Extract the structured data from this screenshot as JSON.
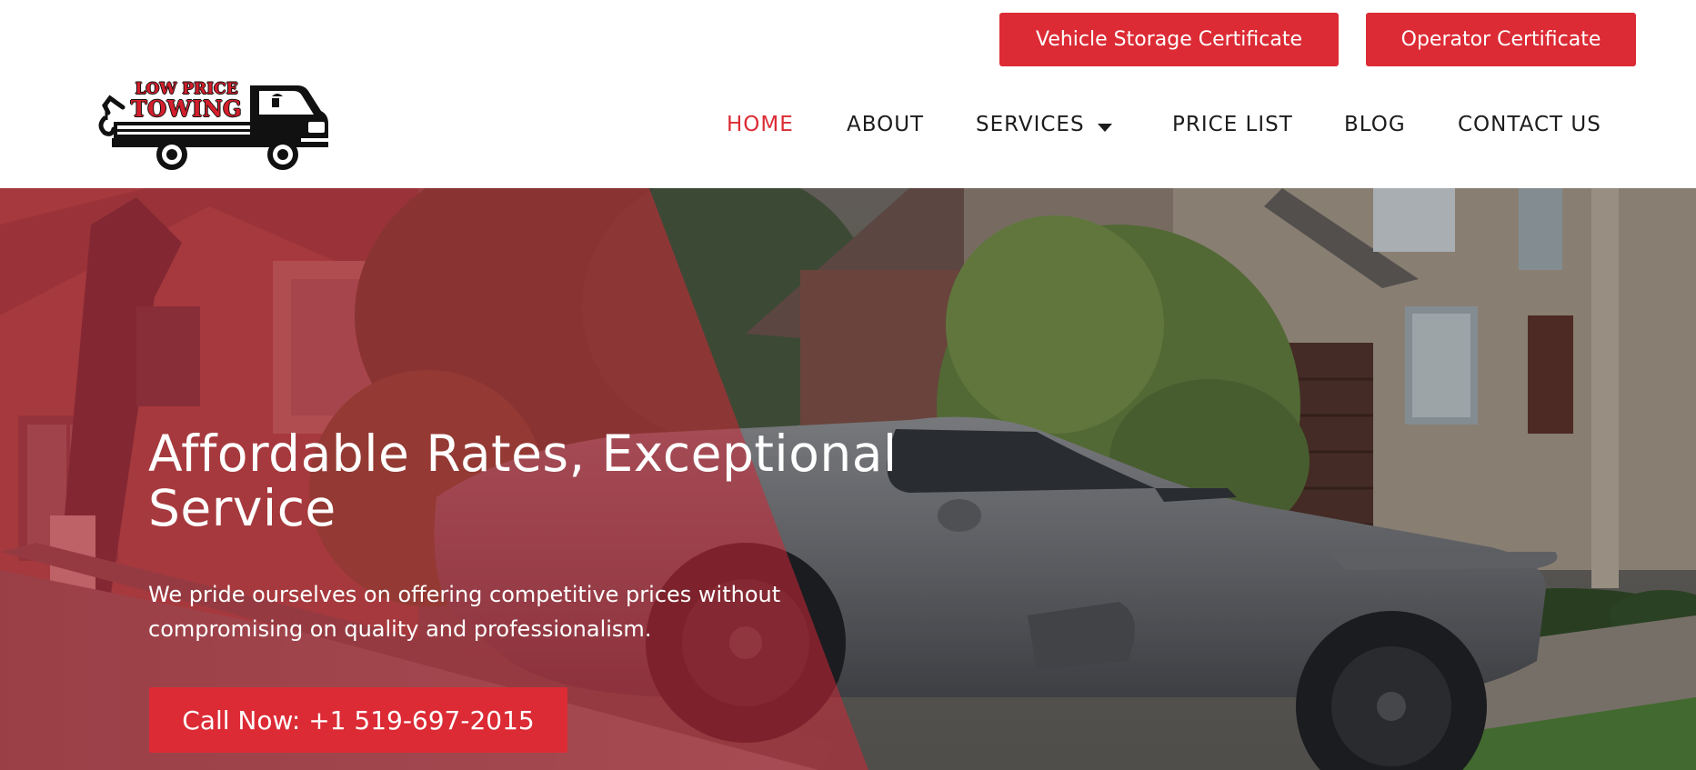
{
  "header": {
    "top_buttons": {
      "storage_certificate": "Vehicle Storage Certificate",
      "operator_certificate": "Operator Certificate"
    },
    "logo": {
      "line1": "LOW PRICE",
      "line2": "TOWING",
      "icon": "tow-truck-logo"
    },
    "nav": {
      "home": "HOME",
      "about": "ABOUT",
      "services": "SERVICES",
      "price_list": "PRICE LIST",
      "blog": "BLOG",
      "contact": "CONTACT US",
      "active": "home",
      "services_icon": "caret-down-icon"
    }
  },
  "hero": {
    "title": "Affordable Rates, Exceptional Service",
    "subtitle": "We pride ourselves on offering competitive prices without compromising on quality and professionalism.",
    "cta_label": "Call Now: +1 519-697-2015",
    "background_image": "tow-truck-and-silver-sports-car-in-front-of-brick-house"
  },
  "colors": {
    "accent": "#dc2b35",
    "nav_text": "#1c1c1c",
    "white": "#ffffff"
  }
}
